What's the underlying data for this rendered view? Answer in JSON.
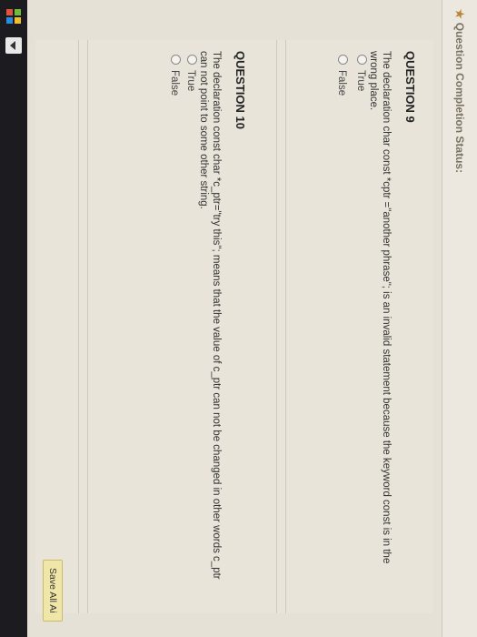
{
  "status": {
    "label": "Question Completion Status:"
  },
  "questions": [
    {
      "title": "QUESTION 9",
      "text": "The declaration char const *cptr =\"another phrase\"; is an invalid statement because the keyword const is in the wrong place.",
      "options": [
        "True",
        "False"
      ]
    },
    {
      "title": "QUESTION 10",
      "text": "The declaration const char *c_ptr=\"try this\"; means that the value of c_ptr can not be changed in other words c_ptr can not point to some other string.",
      "options": [
        "True",
        "False"
      ]
    }
  ],
  "actions": {
    "save_all": "Save All Ai"
  },
  "icons": {
    "taskbar": [
      "windows-icon",
      "arrow-icon"
    ]
  }
}
